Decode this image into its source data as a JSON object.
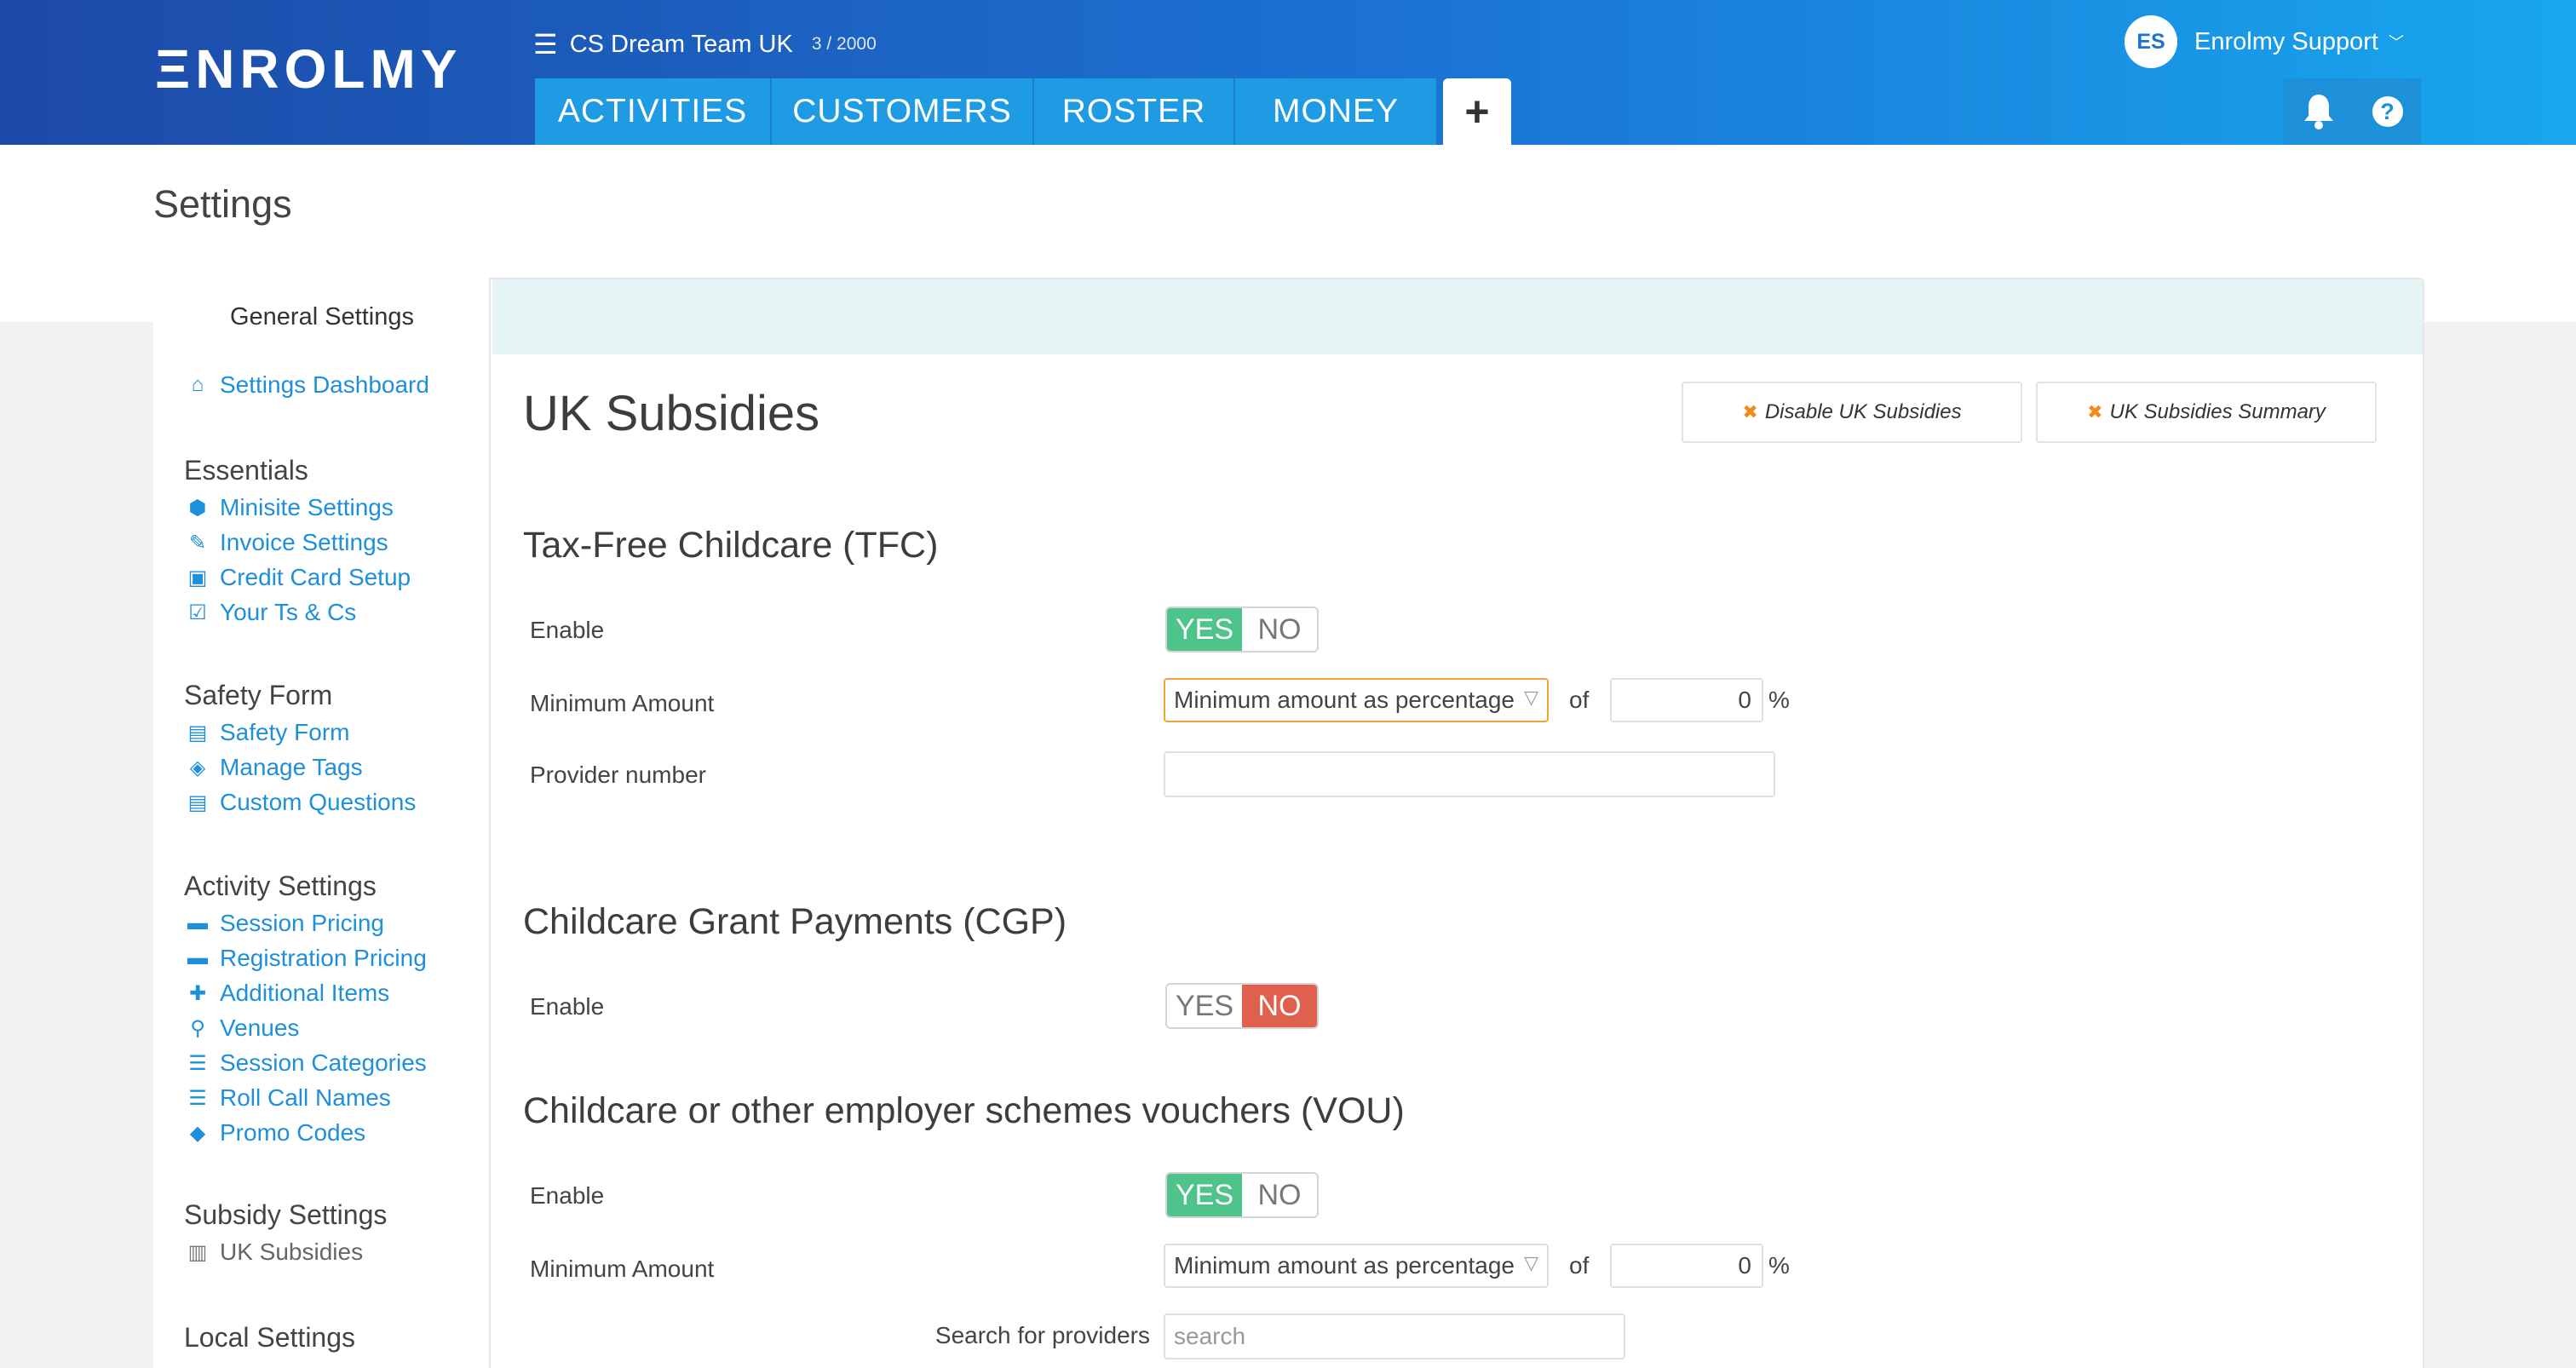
{
  "header": {
    "logo": "ΞNROLMY",
    "org_name": "CS Dream Team UK",
    "org_count": "3 / 2000",
    "tabs": [
      "ACTIVITIES",
      "CUSTOMERS",
      "ROSTER",
      "MONEY"
    ],
    "add_tab": "+",
    "user_initials": "ES",
    "user_name": "Enrolmy Support",
    "help": "?"
  },
  "page": {
    "title": "Settings"
  },
  "sidebar": {
    "title": "General Settings",
    "dashboard": "Settings Dashboard",
    "essentials": {
      "heading": "Essentials",
      "items": [
        "Minisite Settings",
        "Invoice Settings",
        "Credit Card Setup",
        "Your Ts & Cs"
      ]
    },
    "safety": {
      "heading": "Safety Form",
      "items": [
        "Safety Form",
        "Manage Tags",
        "Custom Questions"
      ]
    },
    "activity": {
      "heading": "Activity Settings",
      "items": [
        "Session Pricing",
        "Registration Pricing",
        "Additional Items",
        "Venues",
        "Session Categories",
        "Roll Call Names",
        "Promo Codes"
      ]
    },
    "subsidy": {
      "heading": "Subsidy Settings",
      "items": [
        "UK Subsidies"
      ]
    },
    "local": {
      "heading": "Local Settings"
    }
  },
  "main": {
    "title": "UK Subsidies",
    "buttons": {
      "disable": "Disable UK Subsidies",
      "summary": "UK Subsidies Summary"
    },
    "tfc": {
      "heading": "Tax-Free Childcare (TFC)",
      "enable_label": "Enable",
      "enabled": true,
      "min_label": "Minimum Amount",
      "min_select": "Minimum amount as percentage",
      "of": "of",
      "min_value": "0",
      "pct": "%",
      "provider_label": "Provider number",
      "provider_value": ""
    },
    "cgp": {
      "heading": "Childcare Grant Payments (CGP)",
      "enable_label": "Enable",
      "enabled": false
    },
    "vou": {
      "heading": "Childcare or other employer schemes vouchers (VOU)",
      "enable_label": "Enable",
      "enabled": true,
      "min_label": "Minimum Amount",
      "min_select": "Minimum amount as percentage",
      "of": "of",
      "min_value": "0",
      "pct": "%",
      "search_label": "Search for providers",
      "search_placeholder": "search"
    },
    "toggle_yes": "YES",
    "toggle_no": "NO"
  },
  "colors": {
    "brand_start": "#1d4aa8",
    "brand_end": "#18a7ee",
    "link": "#1e8fd9",
    "yes": "#4fc48a",
    "no": "#e0604f",
    "accent_orange": "#f08a1c"
  }
}
